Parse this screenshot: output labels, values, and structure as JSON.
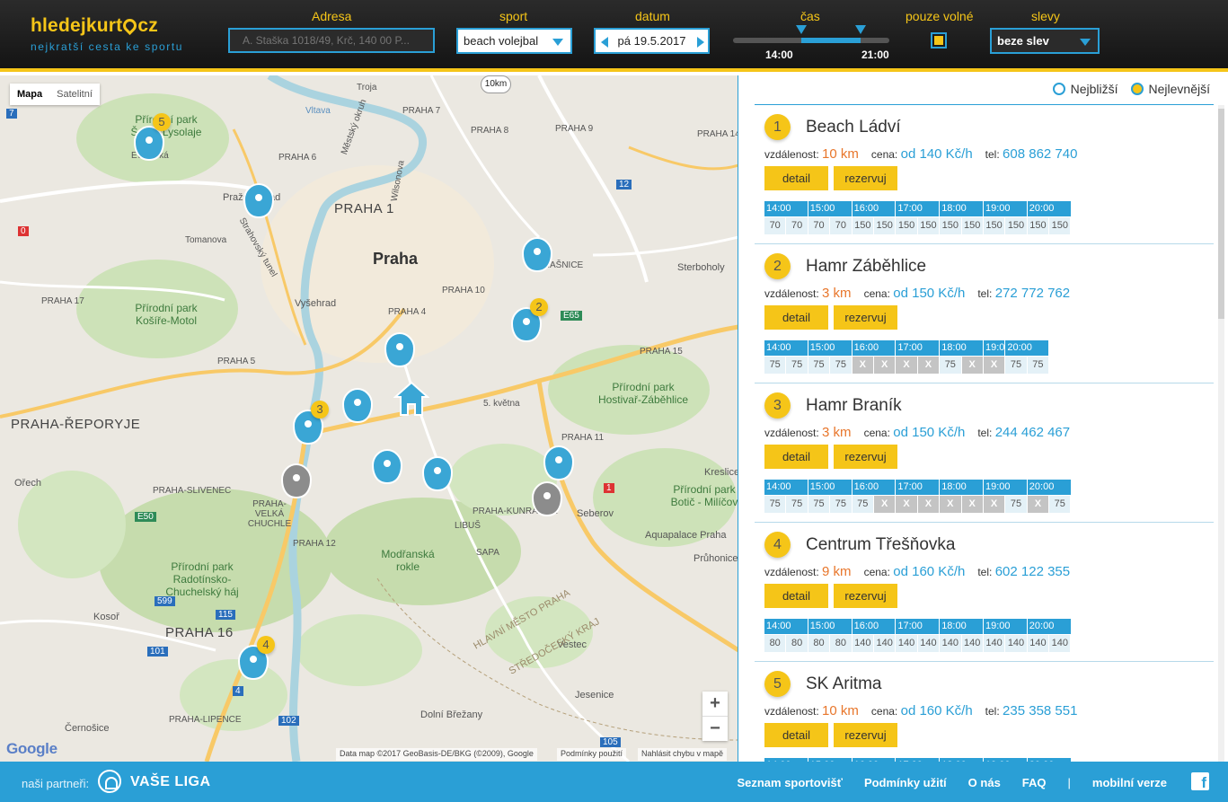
{
  "header": {
    "logo_main": "hledejkurt",
    "logo_tld": "cz",
    "tagline": "nejkratší cesta ke sportu",
    "labels": {
      "address": "Adresa",
      "sport": "sport",
      "date": "datum",
      "time": "čas",
      "only_free": "pouze volné",
      "discounts": "slevy"
    },
    "address_placeholder": "A. Staška 1018/49, Krč, 140 00 P...",
    "sport_value": "beach volejbal",
    "date_value": "pá 19.5.2017",
    "time_from": "14:00",
    "time_to": "21:00",
    "only_free_checked": true,
    "discount_value": "beze slev"
  },
  "map": {
    "tabs": [
      "Mapa",
      "Satelitní"
    ],
    "active_tab": "Mapa",
    "scale_badge": "10km",
    "zoom_in": "+",
    "zoom_out": "−",
    "google": "Google",
    "attribution": "Data map ©2017 GeoBasis-DE/BKG (©2009), Google",
    "terms": "Podmínky použití",
    "report": "Nahlásit chybu v mapě",
    "labels": [
      "Praha",
      "PRAHA 1",
      "Vyšehrad",
      "Troja",
      "PRAHA 6",
      "PRAHA 7",
      "PRAHA 8",
      "PRAHA 9",
      "PRAHA 14",
      "PRAHA 17",
      "PRAHA 5",
      "PRAHA 4",
      "PRAHA 10",
      "PRAHA 15",
      "PRAHA 11",
      "PRAHA 12",
      "PRAHA 16",
      "PRAHA-ŘEPORYJE",
      "PRAHA-SLIVENEC",
      "PRAHA-VELKÁ CHUCHLE",
      "PRAHA-LIPENCE",
      "PRAHA-KUNRATICE",
      "STRAŠNICE",
      "Sterboholy",
      "Kreslice",
      "Seberov",
      "Aquapalace Praha",
      "Průhonice",
      "Vestec",
      "Jesenice",
      "Dolní Břežany",
      "Kosoř",
      "Černošice",
      "Ořech",
      "LIBUŠ",
      "SAPA",
      "Vltava",
      "Evropská",
      "Tomanova",
      "5. května",
      "Modřanská rokle",
      "HLAVNÍ MĚSTO PRAHA",
      "STŘEDOČESKÝ KRAJ",
      "Pražský hrad",
      "Strahovský tunel",
      "Městský okruh",
      "Wilsonova",
      "Přírodní park Šárka-Lysolaje",
      "Přírodní park Košíře-Motol",
      "Přírodní park Hostivař-Záběhlice",
      "Přírodní park Radotínsko-Chuchelský háj",
      "Přírodní park Botič - Milíčov"
    ],
    "route_numbers": [
      "7",
      "0",
      "12",
      "E65",
      "E50",
      "115",
      "101",
      "599",
      "4",
      "102",
      "105",
      "1"
    ]
  },
  "panel": {
    "legend": {
      "nearest": "Nejbližší",
      "cheapest": "Nejlevnější"
    },
    "field_labels": {
      "distance": "vzdálenost:",
      "price": "cena:",
      "tel": "tel:"
    },
    "buttons": {
      "detail": "detail",
      "book": "rezervuj"
    },
    "hours": [
      "14:00",
      "15:00",
      "16:00",
      "17:00",
      "18:00",
      "19:00",
      "20:00"
    ],
    "courts": [
      {
        "num": "1",
        "name": "Beach Ládví",
        "distance": "10 km",
        "price": "od 140 Kč/h",
        "tel": "608 862 740",
        "slots": [
          "70",
          "70",
          "70",
          "70",
          "150",
          "150",
          "150",
          "150",
          "150",
          "150",
          "150",
          "150",
          "150",
          "150"
        ]
      },
      {
        "num": "2",
        "name": "Hamr Záběhlice",
        "distance": "3 km",
        "price": "od 150 Kč/h",
        "tel": "272 772 762",
        "slots": [
          "75",
          "75",
          "75",
          "75",
          "X",
          "X",
          "X",
          "X",
          "75",
          "X",
          "X",
          "75",
          "75"
        ]
      },
      {
        "num": "3",
        "name": "Hamr Braník",
        "distance": "3 km",
        "price": "od 150 Kč/h",
        "tel": "244 462 467",
        "slots": [
          "75",
          "75",
          "75",
          "75",
          "75",
          "X",
          "X",
          "X",
          "X",
          "X",
          "X",
          "75",
          "X",
          "75"
        ]
      },
      {
        "num": "4",
        "name": "Centrum Třešňovka",
        "distance": "9 km",
        "price": "od 160 Kč/h",
        "tel": "602 122 355",
        "slots": [
          "80",
          "80",
          "80",
          "80",
          "140",
          "140",
          "140",
          "140",
          "140",
          "140",
          "140",
          "140",
          "140",
          "140"
        ]
      },
      {
        "num": "5",
        "name": "SK Aritma",
        "distance": "10 km",
        "price": "od 160 Kč/h",
        "tel": "235 358 551",
        "slots": []
      }
    ]
  },
  "footer": {
    "partners": "naši partneři:",
    "liga": "VAŠE LIGA",
    "links": [
      "Seznam sportovišť",
      "Podmínky užití",
      "O nás",
      "FAQ",
      "|",
      "mobilní verze"
    ],
    "fb": "f"
  },
  "colors": {
    "accent_blue": "#2a9fd6",
    "accent_yellow": "#f5c518",
    "header_bg": "#1c1c1c",
    "distance_orange": "#e8762b"
  }
}
